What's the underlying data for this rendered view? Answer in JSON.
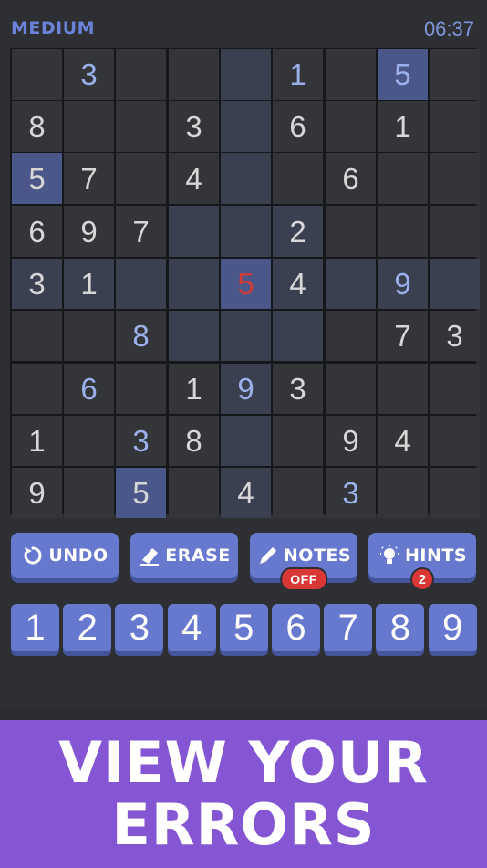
{
  "header": {
    "difficulty": "MEDIUM",
    "timer": "06:37"
  },
  "board": {
    "rows": [
      [
        "",
        "3",
        "",
        "",
        "",
        "1",
        "",
        "5",
        ""
      ],
      [
        "8",
        "",
        "",
        "3",
        "",
        "6",
        "",
        "1",
        ""
      ],
      [
        "5",
        "7",
        "",
        "4",
        "",
        "",
        "6",
        "",
        ""
      ],
      [
        "6",
        "9",
        "7",
        "",
        "",
        "2",
        "",
        "",
        ""
      ],
      [
        "3",
        "1",
        "",
        "",
        "5",
        "4",
        "",
        "9",
        ""
      ],
      [
        "",
        "",
        "8",
        "",
        "",
        "",
        "",
        "7",
        "3"
      ],
      [
        "",
        "6",
        "",
        "1",
        "9",
        "3",
        "",
        "",
        ""
      ],
      [
        "1",
        "",
        "3",
        "8",
        "",
        "",
        "9",
        "4",
        ""
      ],
      [
        "9",
        "",
        "5",
        "",
        "4",
        "",
        "3",
        "",
        ""
      ]
    ],
    "kinds": [
      [
        "",
        "u",
        "",
        "",
        "",
        "u",
        "",
        "u",
        ""
      ],
      [
        "g",
        "",
        "",
        "g",
        "",
        "g",
        "",
        "g",
        ""
      ],
      [
        "g",
        "g",
        "",
        "g",
        "",
        "",
        "g",
        "",
        ""
      ],
      [
        "g",
        "g",
        "g",
        "",
        "",
        "g",
        "",
        "",
        ""
      ],
      [
        "g",
        "g",
        "",
        "",
        "e",
        "g",
        "",
        "u",
        ""
      ],
      [
        "",
        "",
        "u",
        "",
        "",
        "",
        "",
        "g",
        "g"
      ],
      [
        "",
        "u",
        "",
        "g",
        "u",
        "g",
        "",
        "",
        ""
      ],
      [
        "g",
        "",
        "u",
        "g",
        "",
        "",
        "g",
        "g",
        ""
      ],
      [
        "g",
        "",
        "g",
        "",
        "g",
        "",
        "u",
        "",
        ""
      ]
    ],
    "selected": {
      "row": 4,
      "col": 4
    },
    "selected_value": "5"
  },
  "tools": {
    "undo": {
      "label": "UNDO",
      "icon": "undo-icon"
    },
    "erase": {
      "label": "ERASE",
      "icon": "eraser-icon"
    },
    "notes": {
      "label": "NOTES",
      "icon": "pencil-icon",
      "badge": "OFF"
    },
    "hints": {
      "label": "HINTS",
      "icon": "lightbulb-icon",
      "badge": "2"
    }
  },
  "numpad": [
    "1",
    "2",
    "3",
    "4",
    "5",
    "6",
    "7",
    "8",
    "9"
  ],
  "banner": {
    "line1": "VIEW YOUR",
    "line2": "ERRORS"
  },
  "colors": {
    "accent": "#6679cf",
    "error": "#cc3b3b",
    "banner": "#8456d4",
    "user_digit": "#9cb0ec"
  }
}
